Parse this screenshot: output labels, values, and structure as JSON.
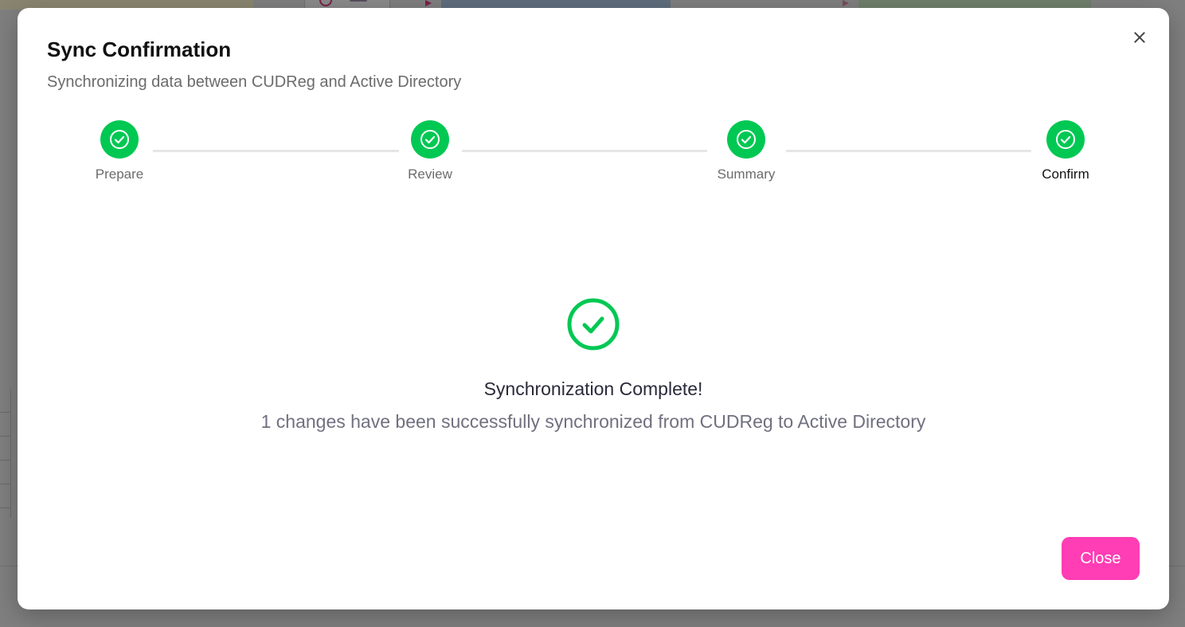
{
  "modal": {
    "title": "Sync Confirmation",
    "subtitle": "Synchronizing data between CUDReg and Active Directory",
    "close_icon": "close-icon"
  },
  "steps": [
    {
      "label": "Prepare",
      "status": "complete",
      "icon": "check-circle-icon"
    },
    {
      "label": "Review",
      "status": "complete",
      "icon": "check-circle-icon"
    },
    {
      "label": "Summary",
      "status": "complete",
      "icon": "check-circle-icon"
    },
    {
      "label": "Confirm",
      "status": "current",
      "icon": "check-circle-icon"
    }
  ],
  "result": {
    "icon": "success-check-icon",
    "title": "Synchronization Complete!",
    "message": "1 changes have been successfully synchronized from CUDReg to Active Directory"
  },
  "footer": {
    "close_label": "Close"
  },
  "colors": {
    "success": "#00c853",
    "primary_button": "#ff3db4",
    "overlay": "#7f7f7f"
  }
}
